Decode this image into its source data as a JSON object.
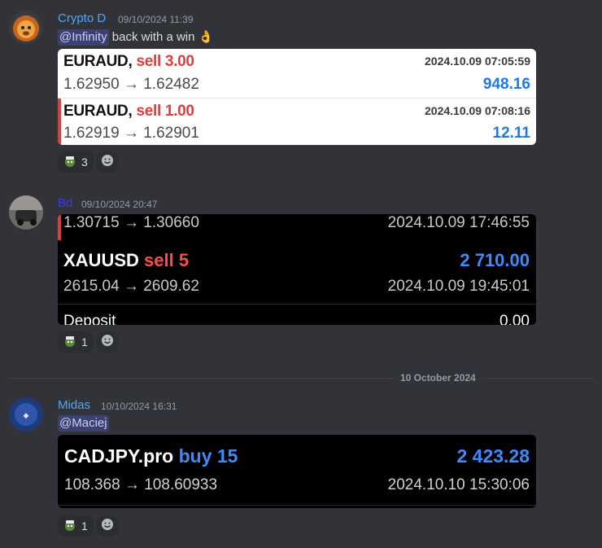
{
  "messages": [
    {
      "username": "Crypto D",
      "username_color": "#4ea8ff",
      "timestamp": "09/10/2024 11:39",
      "mention": "@Infinity",
      "text": "back with a win",
      "emoji": "👌",
      "trades": [
        {
          "symbol": "EURAUD,",
          "side": "sell 3.00",
          "datetime": "2024.10.09 07:05:59",
          "prices": "1.62950 → 1.62482",
          "profit": "948.16"
        },
        {
          "symbol": "EURAUD,",
          "side": "sell 1.00",
          "datetime": "2024.10.09 07:08:16",
          "prices": "1.62919 → 1.62901",
          "profit": "12.11"
        }
      ],
      "reaction_count": "3"
    },
    {
      "username": "Bd",
      "username_color": "#3c3ae8",
      "timestamp": "09/10/2024 20:47",
      "trades": [
        {
          "prices": "1.30715 → 1.30660",
          "datetime": "2024.10.09 17:46:55"
        },
        {
          "symbol": "XAUUSD",
          "side": "sell 5",
          "profit": "2 710.00",
          "prices": "2615.04 → 2609.62",
          "datetime": "2024.10.09 19:45:01"
        }
      ],
      "deposit_label": "Deposit",
      "deposit_value": "0.00",
      "reaction_count": "1"
    },
    {
      "username": "Midas",
      "username_color": "#4ea8ff",
      "timestamp": "10/10/2024 16:31",
      "mention": "@Maciej",
      "trades": [
        {
          "symbol": "CADJPY.pro",
          "side": "buy 15",
          "profit": "2 423.28",
          "prices": "108.368 → 108.60933",
          "datetime": "2024.10.10 15:30:06"
        }
      ],
      "reaction_count": "1"
    }
  ],
  "date_divider": "10 October 2024",
  "icons": {
    "reaction": "pepe-emoji-icon",
    "add_reaction": "smile-icon"
  }
}
